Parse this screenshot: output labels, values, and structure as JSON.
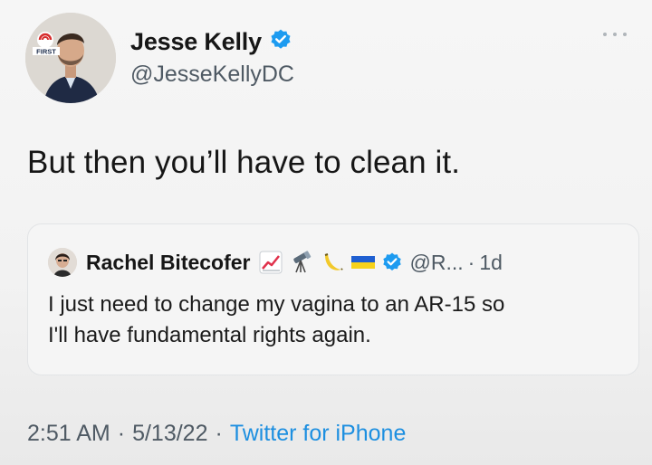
{
  "tweet": {
    "author": {
      "display_name": "Jesse Kelly",
      "handle": "@JesseKellyDC",
      "verified": true,
      "avatar_badge": "FIRST"
    },
    "text": "But then you’ll have to clean it.",
    "quote": {
      "author": {
        "display_name": "Rachel Bitecofer",
        "emojis": [
          "chart-increasing-emoji",
          "telescope-emoji",
          "banana-emoji",
          "ukraine-flag-emoji"
        ],
        "verified": true,
        "handle": "@R...",
        "separator": "·",
        "time": "1d"
      },
      "text_line1": "I just need to change my vagina to an AR-15 so",
      "text_line2": "I'll have fundamental rights again."
    },
    "meta": {
      "time": "2:51 AM",
      "sep1": "·",
      "date": "5/13/22",
      "sep2": "·",
      "source": "Twitter for iPhone"
    }
  },
  "colors": {
    "verified_blue": "#1d9bf0",
    "link_blue": "#1d8fe0",
    "secondary_text": "#4f5a64"
  },
  "icons": [
    "verified-badge-icon",
    "more-options-icon"
  ]
}
